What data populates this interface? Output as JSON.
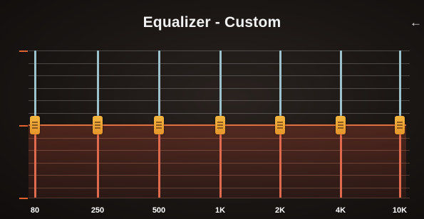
{
  "header": {
    "title": "Equalizer - Custom",
    "back_icon": "back-arrow-icon",
    "back_glyph": "←"
  },
  "colors": {
    "accent": "#e2703e",
    "upper_track": "#9ec2cc",
    "lower_track": "#e06a4e",
    "thumb": "#f0a838"
  },
  "bands": [
    {
      "label": "80",
      "level": 0
    },
    {
      "label": "250",
      "level": 0
    },
    {
      "label": "500",
      "level": 0
    },
    {
      "label": "1K",
      "level": 0
    },
    {
      "label": "2K",
      "level": 0
    },
    {
      "label": "4K",
      "level": 0
    },
    {
      "label": "10K",
      "level": 0
    }
  ]
}
